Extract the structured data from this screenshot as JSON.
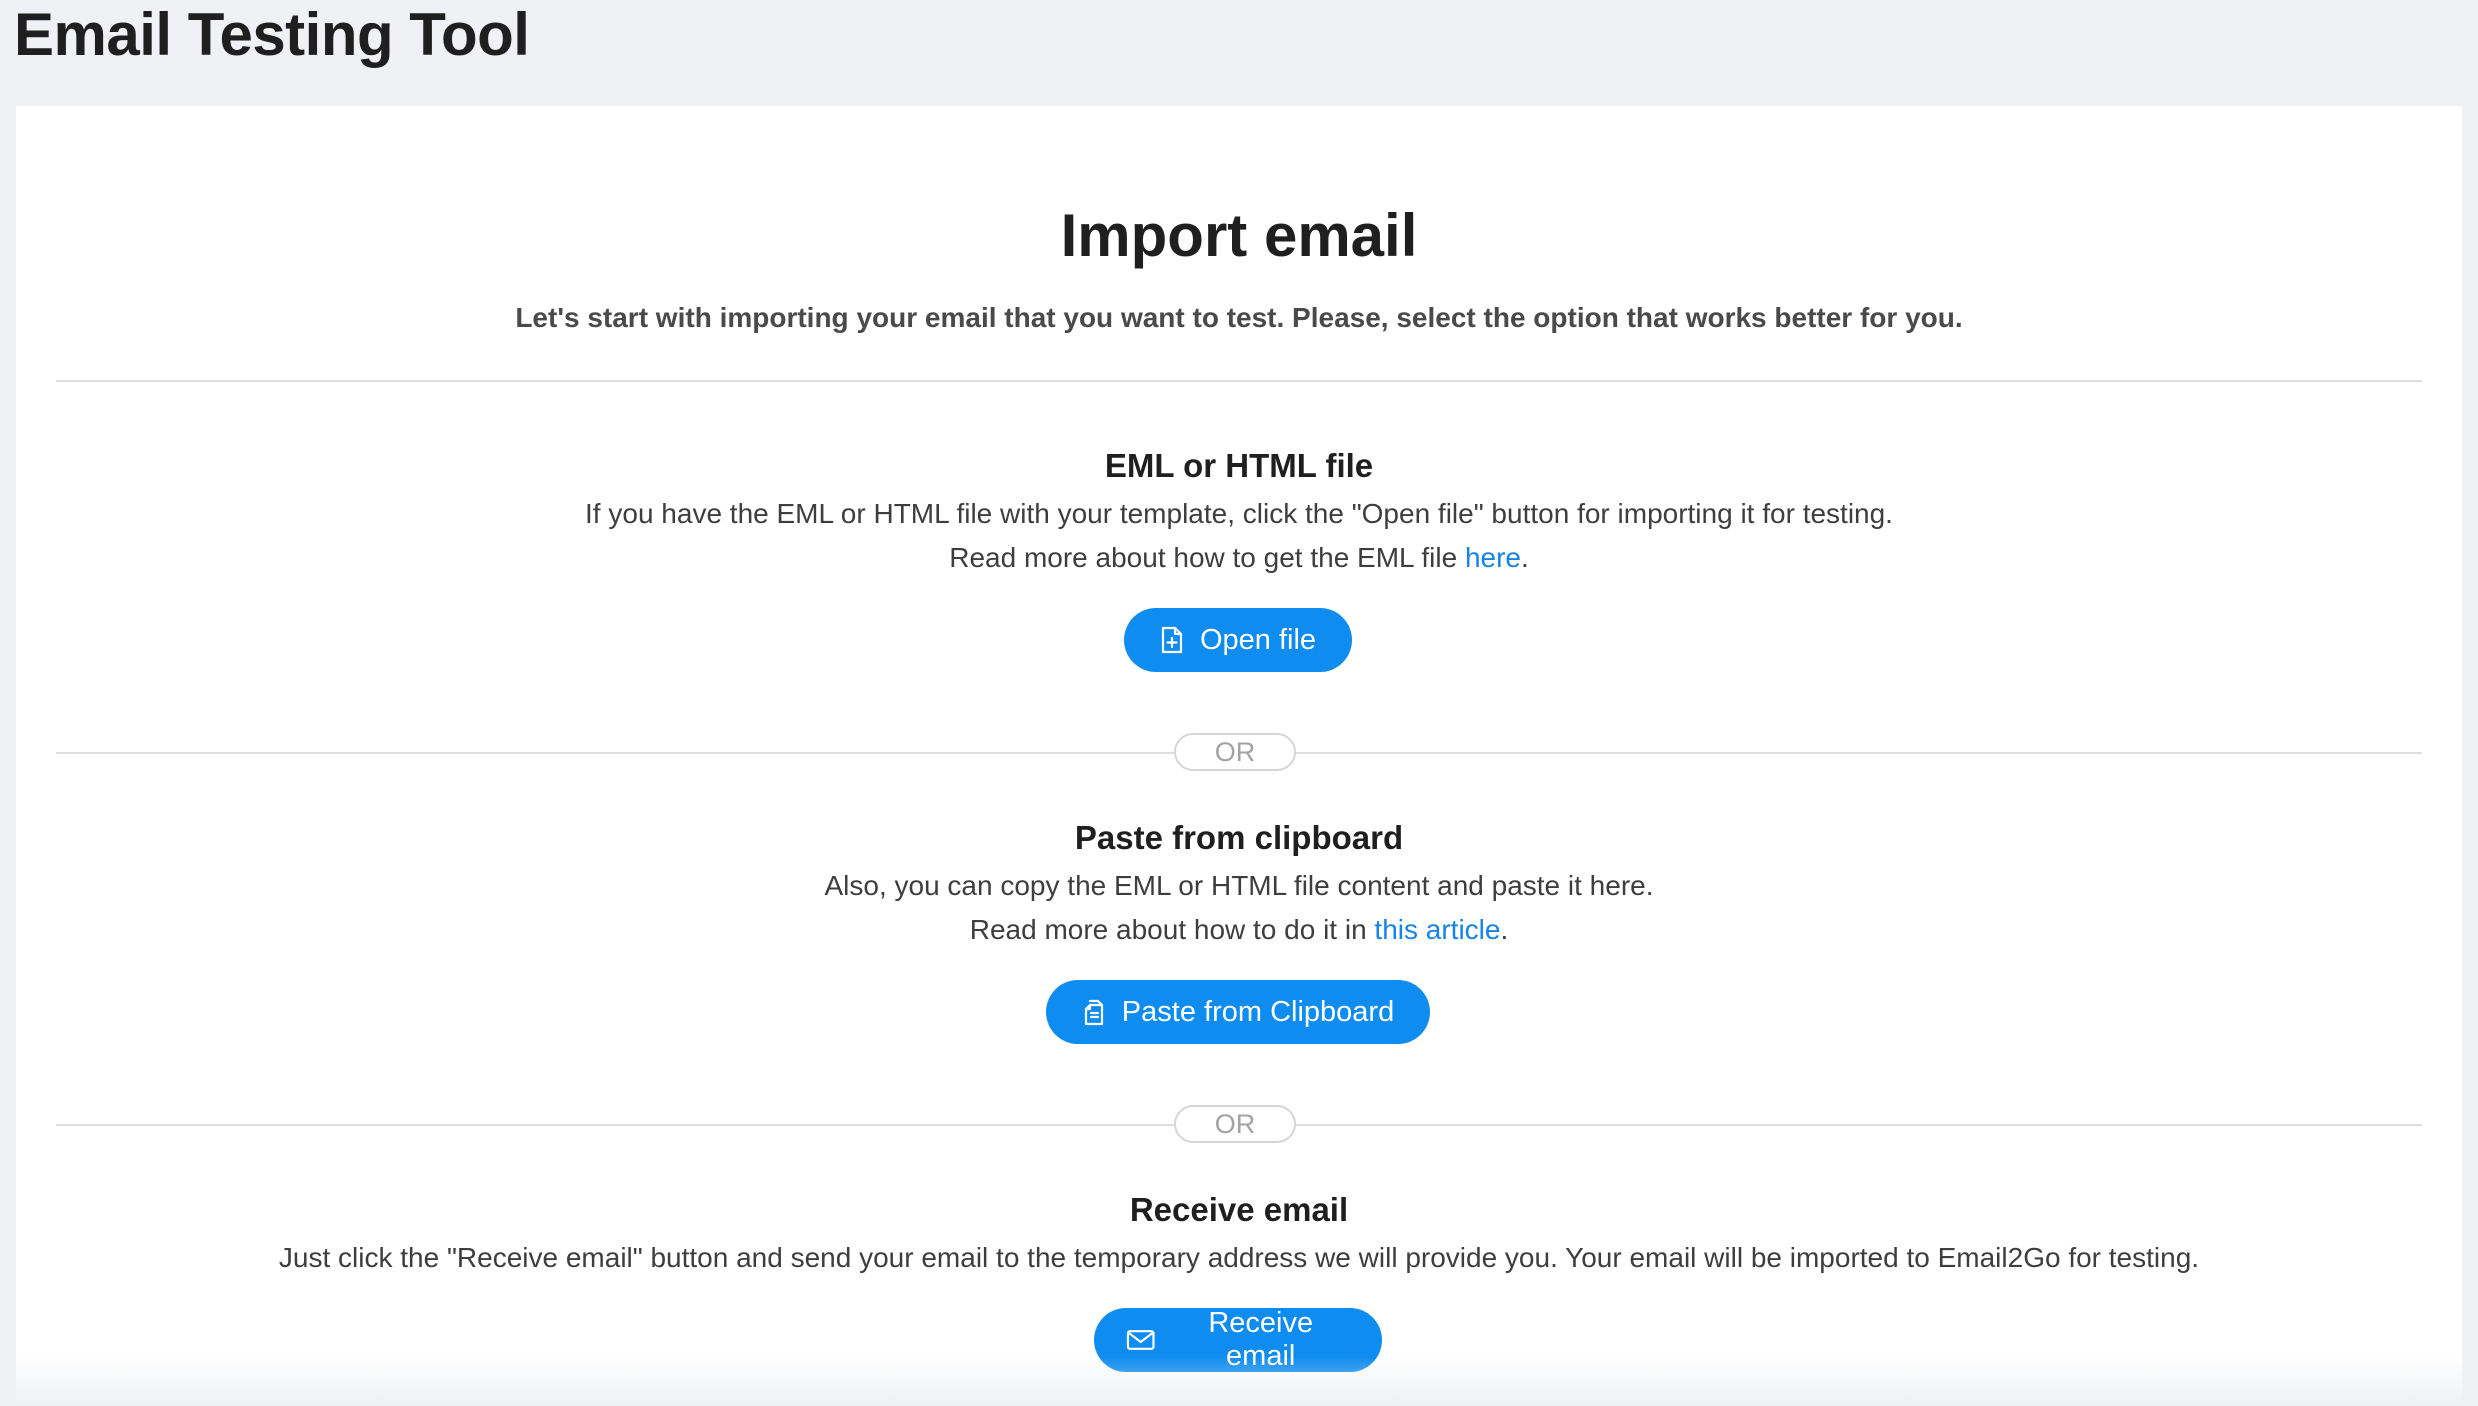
{
  "app": {
    "title": "Email Testing Tool"
  },
  "import": {
    "heading": "Import email",
    "subtitle": "Let's start with importing your email that you want to test. Please, select the option that works better for you."
  },
  "separator_label": "OR",
  "sections": {
    "file": {
      "title": "EML or HTML file",
      "line1": "If you have the EML or HTML file with your template, click the \"Open file\" button for importing it for testing.",
      "line2_prefix": "Read more about how to get the EML file ",
      "line2_link": "here",
      "line2_suffix": ".",
      "button_label": "Open file",
      "button_icon": "file-plus-icon"
    },
    "clipboard": {
      "title": "Paste from clipboard",
      "line1": "Also, you can copy the EML or HTML file content and paste it here.",
      "line2_prefix": "Read more about how to do it in ",
      "line2_link": "this article",
      "line2_suffix": ".",
      "button_label": "Paste from Clipboard",
      "button_icon": "clipboard-icon"
    },
    "receive": {
      "title": "Receive email",
      "line1": "Just click the \"Receive email\" button and send your email to the temporary address we will provide you. Your email will be imported to Email2Go for testing.",
      "button_label": "Receive email",
      "button_icon": "envelope-icon"
    }
  },
  "colors": {
    "page_background": "#f0f1f4",
    "card_background": "#ffffff",
    "primary_button": "#0e8cf0",
    "link": "#1584e6",
    "divider": "#dedede"
  }
}
